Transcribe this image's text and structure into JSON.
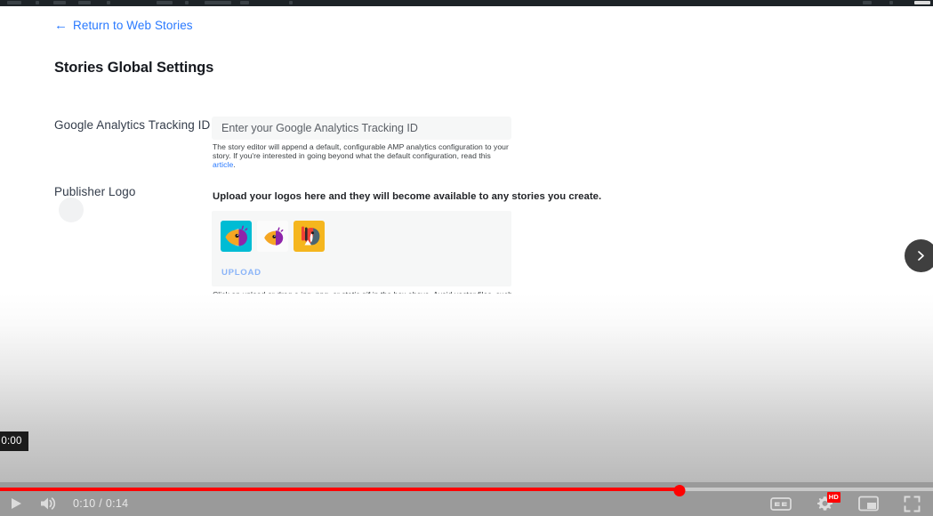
{
  "colors": {
    "link_blue": "#2979ff",
    "upload_blue": "#8ab4f8",
    "progress_red": "#ff0000",
    "player_chrome": "#9a9a9a",
    "field_bg": "#f6f7f7",
    "admin_bar": "#1d2327"
  },
  "nav": {
    "return_link_label": "Return to Web Stories",
    "back_arrow_icon": "arrow-left-icon"
  },
  "header": {
    "title": "Stories Global Settings"
  },
  "settings": {
    "analytics": {
      "label": "Google Analytics Tracking ID",
      "input_value": "",
      "input_placeholder": "Enter your Google Analytics Tracking ID",
      "helper_text_before": "The story editor will append a default, configurable AMP analytics configuration to your story. If you're interested in going beyond what the default configuration, read this ",
      "helper_link_label": "article",
      "helper_text_after": "."
    },
    "publisher_logo": {
      "label": "Publisher Logo",
      "intro": "Upload your logos here and they will become available to any stories you create.",
      "upload_button_label": "UPLOAD",
      "helper_text": "Click on upload or drag a jpg, png, or static gif in the box above. Avoid vector files, such as svg or eps. Logos should be at least 96x96 pixels and a perfect square. The background should not be transparent.",
      "logos": [
        {
          "name": "logo-thumbnail-bird-cyan",
          "background": "#00bcd4",
          "accent": "#f5a623",
          "detail": "#8e24aa"
        },
        {
          "name": "logo-thumbnail-bird-white",
          "background": "#fbfbfb",
          "accent": "#f5a623",
          "detail": "#8e24aa"
        },
        {
          "name": "logo-thumbnail-parrot-yellow",
          "background": "#f5b61e",
          "accent": "#ef4136",
          "detail": "#4a6572"
        }
      ]
    }
  },
  "story_nav": {
    "next_button_icon": "chevron-right-icon"
  },
  "player": {
    "hover_time_tooltip": "0:00",
    "play_button_icon": "play-icon",
    "volume_button_icon": "volume-high-icon",
    "time_readout": "0:10 / 0:14",
    "current_time": "0:10",
    "duration": "0:14",
    "progress_percent": 72.8,
    "captions_button_label": "CC",
    "captions_icon": "closed-captions-icon",
    "settings_icon": "gear-icon",
    "quality_badge": "HD",
    "miniplayer_icon": "miniplayer-icon",
    "fullscreen_icon": "fullscreen-icon"
  }
}
